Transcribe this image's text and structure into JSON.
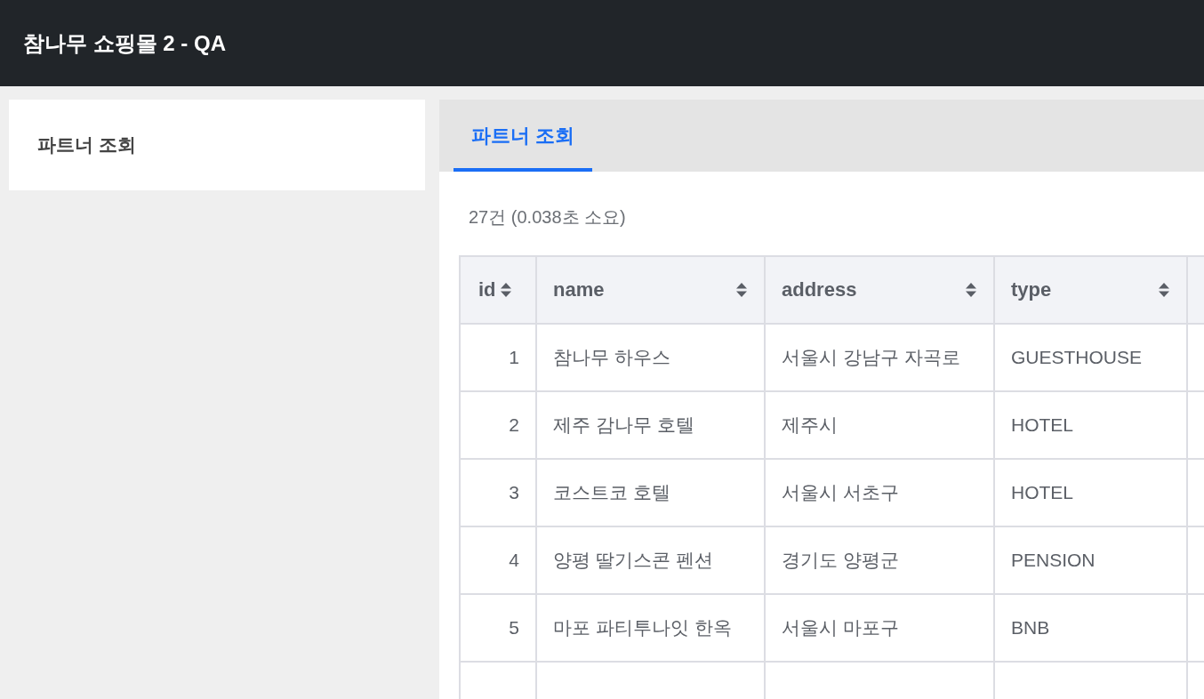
{
  "header": {
    "title": "참나무 쇼핑몰 2 - QA"
  },
  "sidebar": {
    "items": [
      {
        "label": "파트너 조회",
        "selected": true
      }
    ]
  },
  "tabs": [
    {
      "label": "파트너 조회",
      "selected": true
    }
  ],
  "result_summary": "27건 (0.038초 소요)",
  "table": {
    "columns": [
      "id",
      "name",
      "address",
      "type"
    ],
    "rows": [
      {
        "id": "1",
        "name": "참나무 하우스",
        "address": "서울시 강남구 자곡로",
        "type": "GUESTHOUSE"
      },
      {
        "id": "2",
        "name": "제주 감나무 호텔",
        "address": "제주시",
        "type": "HOTEL"
      },
      {
        "id": "3",
        "name": "코스트코 호텔",
        "address": "서울시 서초구",
        "type": "HOTEL"
      },
      {
        "id": "4",
        "name": "양평 딸기스콘 펜션",
        "address": "경기도 양평군",
        "type": "PENSION"
      },
      {
        "id": "5",
        "name": "마포 파티투나잇 한옥",
        "address": "서울시 마포구",
        "type": "BNB"
      }
    ]
  }
}
